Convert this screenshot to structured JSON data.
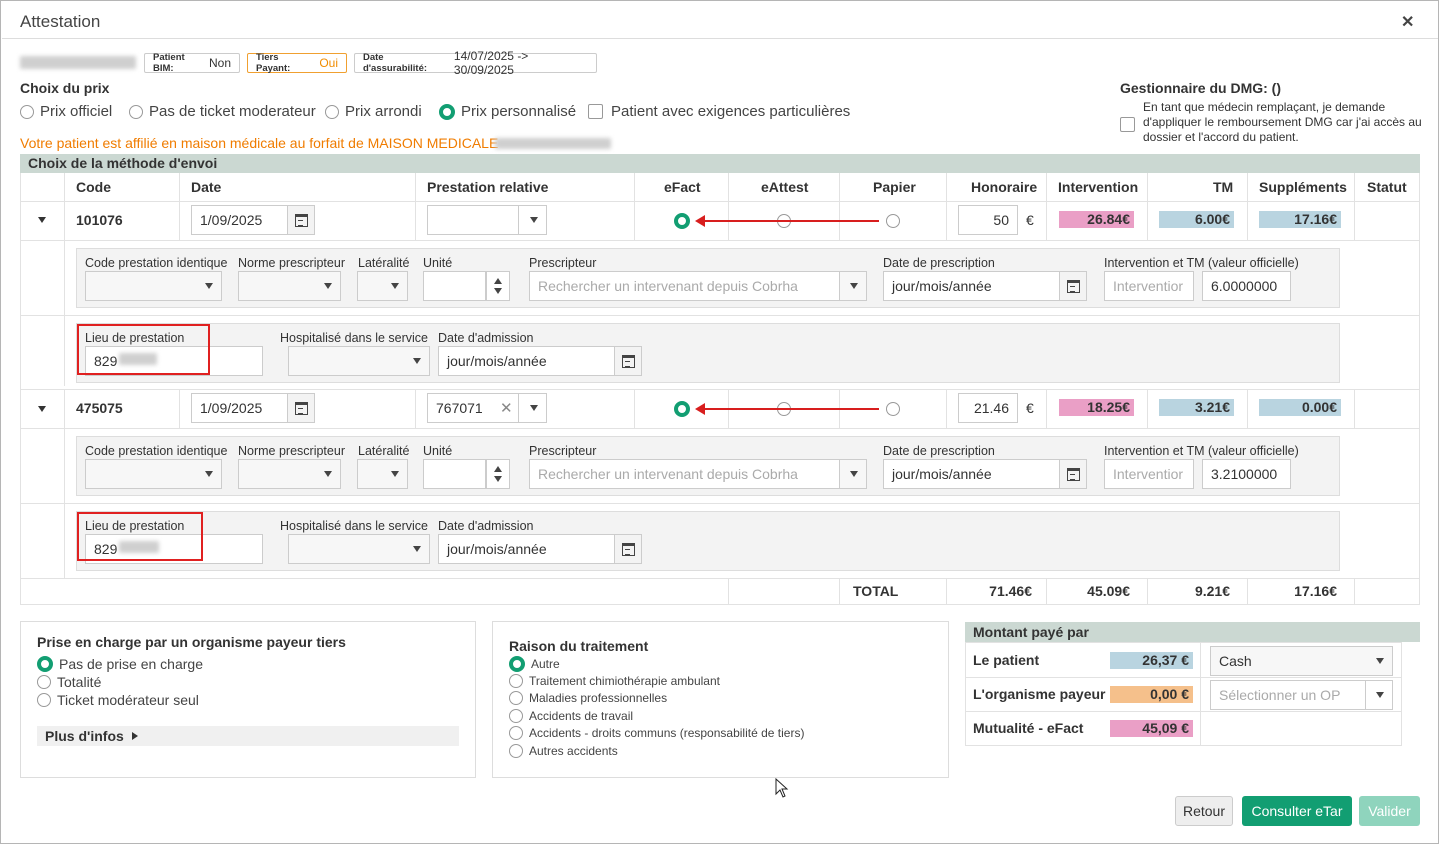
{
  "window": {
    "title": "Attestation"
  },
  "header": {
    "bim_label": "Patient BIM:",
    "bim_value": "Non",
    "tp_label": "Tiers Payant:",
    "tp_value": "Oui",
    "date_label": "Date d'assurabilité:",
    "date_value": "14/07/2025 -> 30/09/2025"
  },
  "price": {
    "title": "Choix du prix",
    "options": [
      "Prix officiel",
      "Pas de ticket moderateur",
      "Prix arrondi",
      "Prix personnalisé"
    ],
    "selected": "Prix personnalisé",
    "special": "Patient avec exigences particulières"
  },
  "dmg": {
    "title": "Gestionnaire du DMG: ()",
    "text": "En tant que médecin remplaçant, je demande d'appliquer le remboursement DMG car j'ai accès au dossier et l'accord du patient."
  },
  "warning": "Votre patient est affilié en maison médicale au forfait de MAISON MEDICALE",
  "method": {
    "title": "Choix de la méthode d'envoi",
    "columns": [
      "Code",
      "Date",
      "Prestation relative",
      "eFact",
      "eAttest",
      "Papier",
      "Honoraire",
      "Intervention",
      "TM",
      "Suppléments",
      "Statut"
    ]
  },
  "detail_labels": {
    "code_ident": "Code prestation identique",
    "norme": "Norme prescripteur",
    "lateralite": "Latéralité",
    "unite": "Unité",
    "prescripteur": "Prescripteur",
    "prescripteur_ph": "Rechercher un intervenant depuis Cobrha",
    "date_presc": "Date de prescription",
    "date_ph": "jour/mois/année",
    "interv_tm": "Intervention et TM (valeur officielle)",
    "interv_ph": "Interventior",
    "lieu": "Lieu de prestation",
    "hosp": "Hospitalisé dans le service",
    "admission": "Date d'admission"
  },
  "rows": [
    {
      "code": "101076",
      "date": "1/09/2025",
      "relative": "",
      "honoraire": "50",
      "currency": "€",
      "intervention": "26.84€",
      "tm": "6.00€",
      "supplements": "17.16€",
      "tm_official": "6.0000000",
      "lieu": "829"
    },
    {
      "code": "475075",
      "date": "1/09/2025",
      "relative": "767071",
      "honoraire": "21.46",
      "currency": "€",
      "intervention": "18.25€",
      "tm": "3.21€",
      "supplements": "0.00€",
      "tm_official": "3.2100000",
      "lieu": "829"
    }
  ],
  "total": {
    "label": "TOTAL",
    "honoraire": "71.46€",
    "intervention": "45.09€",
    "tm": "9.21€",
    "supplements": "17.16€"
  },
  "payer": {
    "title": "Prise en charge par un organisme payeur tiers",
    "options": [
      "Pas de prise en charge",
      "Totalité",
      "Ticket modérateur seul"
    ],
    "more": "Plus d'infos"
  },
  "reason": {
    "title": "Raison du traitement",
    "options": [
      "Autre",
      "Traitement chimiothérapie ambulant",
      "Maladies professionnelles",
      "Accidents de travail",
      "Accidents - droits communs (responsabilité de tiers)",
      "Autres accidents"
    ]
  },
  "paid": {
    "title": "Montant payé par",
    "rows": [
      {
        "label": "Le patient",
        "amount": "26,37 €",
        "select": "Cash"
      },
      {
        "label": "L'organisme payeur",
        "amount": "0,00 €",
        "select": "Sélectionner un OP"
      },
      {
        "label": "Mutualité - eFact",
        "amount": "45,09 €"
      }
    ]
  },
  "buttons": {
    "back": "Retour",
    "etar": "Consulter eTar",
    "validate": "Valider"
  },
  "colors": {
    "accent": "#129e72",
    "warning": "#f07c00",
    "pink": "#ea9fc6",
    "blue": "#b9d4e0",
    "peach": "#f5c08b"
  }
}
